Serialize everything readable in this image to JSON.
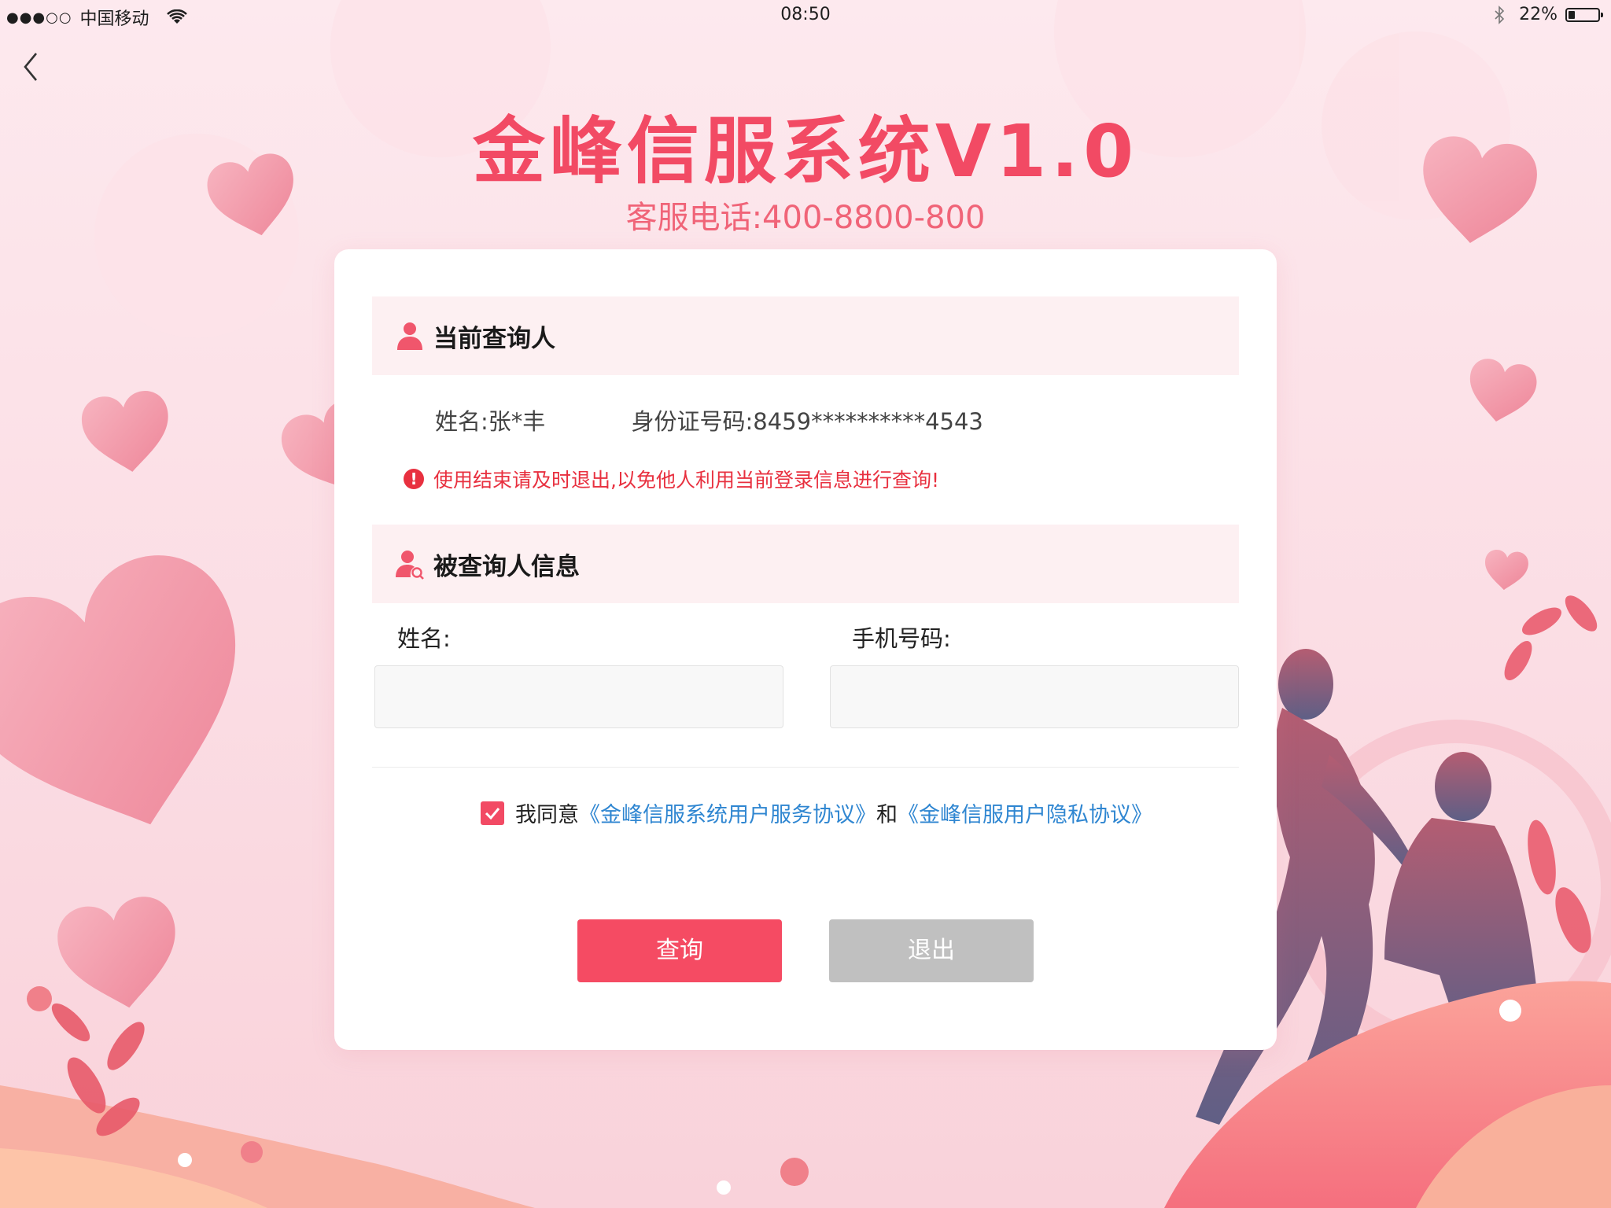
{
  "status_bar": {
    "signal": "●●●○○",
    "carrier": "中国移动",
    "time": "08:50",
    "battery_percent": "22%",
    "battery_level": 0.22
  },
  "header": {
    "title": "金峰信服系统V1.0",
    "subtitle": "客服电话:400-8800-800"
  },
  "current_user": {
    "section_title": "当前查询人",
    "name": "姓名:张*丰",
    "id_number": "身份证号码:8459**********4543",
    "warning": "使用结束请及时退出,以免他人利用当前登录信息进行查询!"
  },
  "queried_person": {
    "section_title": "被查询人信息",
    "name_label": "姓名:",
    "name_value": "",
    "phone_label": "手机号码:",
    "phone_value": ""
  },
  "agreement": {
    "checked": true,
    "prefix": "我同意",
    "link1": "《金峰信服系统用户服务协议》",
    "conjunction": "和",
    "link2": "《金峰信服用户隐私协议》"
  },
  "buttons": {
    "query": "查询",
    "exit": "退出"
  },
  "colors": {
    "accent": "#f24a64",
    "link": "#2f86d1",
    "warning": "#e8303f",
    "disabled": "#c0c0c0"
  }
}
